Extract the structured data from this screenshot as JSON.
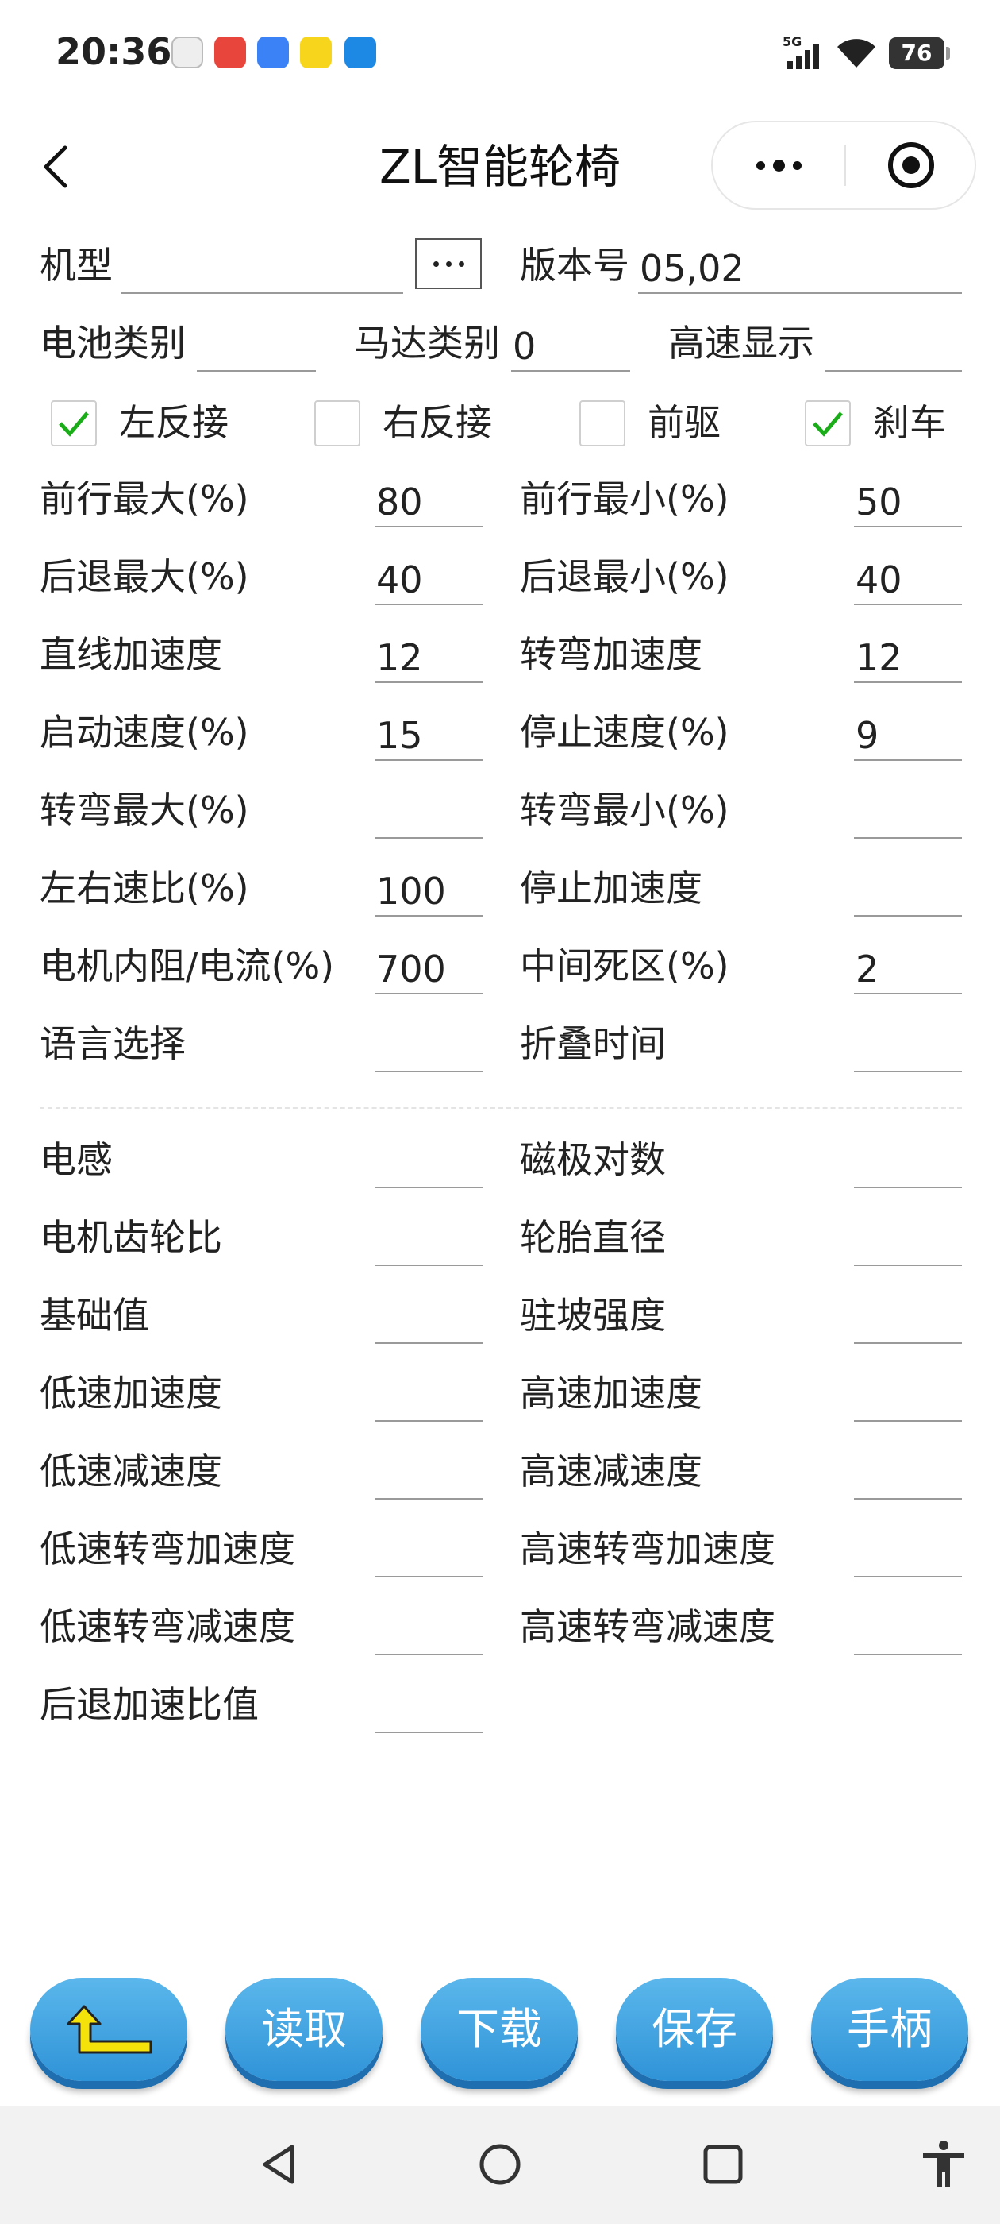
{
  "status_bar": {
    "time": "20:36",
    "network": "5G",
    "battery": "76",
    "icons": [
      "settings-app-icon",
      "clown-app-icon",
      "blue-app-icon",
      "yellow-app-icon",
      "robot-app-icon",
      "signal-icon",
      "wifi-icon",
      "battery-icon"
    ]
  },
  "header": {
    "title": "ZL智能轮椅",
    "back_icon": "chevron-left-icon",
    "more_icon": "more-dots-icon",
    "close_icon": "record-target-icon"
  },
  "info": {
    "model_label": "机型",
    "model_value": "",
    "version_label": "版本号",
    "version_value": "05,02",
    "battery_type_label": "电池类别",
    "battery_type_value": "",
    "motor_type_label": "马达类别",
    "motor_type_value": "0",
    "high_speed_label": "高速显示",
    "high_speed_value": ""
  },
  "checkboxes": [
    {
      "label": "左反接",
      "checked": true
    },
    {
      "label": "右反接",
      "checked": false
    },
    {
      "label": "前驱",
      "checked": false
    },
    {
      "label": "刹车",
      "checked": true
    }
  ],
  "params": [
    {
      "left_label": "前行最大(%)",
      "left_value": "80",
      "right_label": "前行最小(%)",
      "right_value": "50"
    },
    {
      "left_label": "后退最大(%)",
      "left_value": "40",
      "right_label": "后退最小(%)",
      "right_value": "40"
    },
    {
      "left_label": "直线加速度",
      "left_value": "12",
      "right_label": "转弯加速度",
      "right_value": "12"
    },
    {
      "left_label": "启动速度(%)",
      "left_value": "15",
      "right_label": "停止速度(%)",
      "right_value": "9"
    },
    {
      "left_label": "转弯最大(%)",
      "left_value": "",
      "right_label": "转弯最小(%)",
      "right_value": ""
    },
    {
      "left_label": "左右速比(%)",
      "left_value": "100",
      "right_label": "停止加速度",
      "right_value": ""
    },
    {
      "left_label": "电机内阻/电流(%)",
      "left_value": "700",
      "right_label": "中间死区(%)",
      "right_value": "2"
    },
    {
      "left_label": "语言选择",
      "left_value": "",
      "right_label": "折叠时间",
      "right_value": ""
    }
  ],
  "advanced": [
    {
      "left_label": "电感",
      "left_value": "",
      "right_label": "磁极对数",
      "right_value": ""
    },
    {
      "left_label": "电机齿轮比",
      "left_value": "",
      "right_label": "轮胎直径",
      "right_value": ""
    },
    {
      "left_label": "基础值",
      "left_value": "",
      "right_label": "驻坡强度",
      "right_value": ""
    },
    {
      "left_label": "低速加速度",
      "left_value": "",
      "right_label": "高速加速度",
      "right_value": ""
    },
    {
      "left_label": "低速减速度",
      "left_value": "",
      "right_label": "高速减速度",
      "right_value": ""
    },
    {
      "left_label": "低速转弯加速度",
      "left_value": "",
      "right_label": "高速转弯加速度",
      "right_value": ""
    },
    {
      "left_label": "低速转弯减速度",
      "left_value": "",
      "right_label": "高速转弯减速度",
      "right_value": ""
    },
    {
      "left_label": "后退加速比值",
      "left_value": ""
    }
  ],
  "actions": {
    "back_icon": "return-arrow-icon",
    "read": "读取",
    "download": "下载",
    "save": "保存",
    "handle": "手柄"
  },
  "nav": {
    "icons": [
      "nav-back-icon",
      "nav-home-icon",
      "nav-recents-icon",
      "accessibility-icon"
    ]
  },
  "colors": {
    "button_blue": "#3fa4e0",
    "arrow_yellow": "#f5e20a",
    "check_green": "#1aad19"
  }
}
